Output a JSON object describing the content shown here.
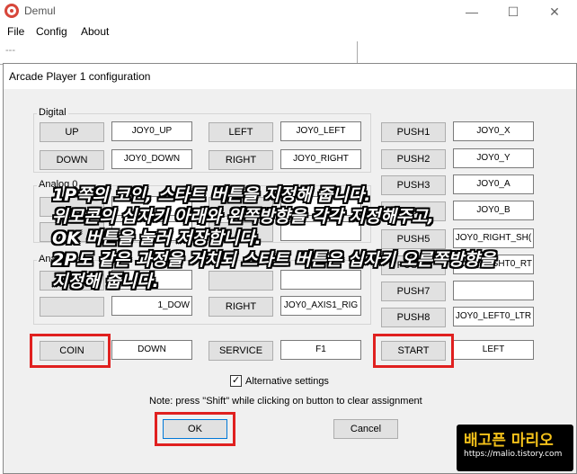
{
  "app": {
    "title": "Demul",
    "menu": [
      "File",
      "Config",
      "About"
    ],
    "status": "---",
    "window_buttons": [
      "—",
      "☐",
      "✕"
    ]
  },
  "dialog": {
    "title": "Arcade Player 1 configuration",
    "groups": {
      "digital": "Digital",
      "analog0": "Analog 0",
      "analog1": "Analog 1"
    },
    "rows": [
      {
        "btn": "UP",
        "val": "JOY0_UP",
        "btn2": "LEFT",
        "val2": "JOY0_LEFT"
      },
      {
        "btn": "DOWN",
        "val": "JOY0_DOWN",
        "btn2": "RIGHT",
        "val2": "JOY0_RIGHT"
      }
    ],
    "analog1_row": {
      "btn": "",
      "val": "1_DOW",
      "btn2": "RIGHT",
      "val2": "JOY0_AXIS1_RIG"
    },
    "push": [
      {
        "btn": "PUSH1",
        "val": "JOY0_X"
      },
      {
        "btn": "PUSH2",
        "val": "JOY0_Y"
      },
      {
        "btn": "PUSH3",
        "val": "JOY0_A"
      },
      {
        "btn": "PUSH4",
        "val": "JOY0_B"
      },
      {
        "btn": "PUSH5",
        "val": "JOY0_RIGHT_SH("
      },
      {
        "btn": "PUSH6",
        "val": "JOY0_RIGHT0_RT"
      },
      {
        "btn": "PUSH7",
        "val": ""
      },
      {
        "btn": "PUSH8",
        "val": "JOY0_LEFT0_LTR"
      }
    ],
    "coin": {
      "btn": "COIN",
      "val": "DOWN"
    },
    "service": {
      "btn": "SERVICE",
      "val": "F1"
    },
    "start": {
      "btn": "START",
      "val": "LEFT"
    },
    "alt_settings": "Alternative settings",
    "alt_checked": true,
    "note": "Note: press \"Shift\" while clicking on button to clear assignment",
    "ok": "OK",
    "cancel": "Cancel"
  },
  "overlay": [
    "1P쪽의 코인, 스타트 버튼을 지정해 줍니다.",
    "위모콘의 십자키 아래와 왼쪽방향을 각각 지정해주고,",
    "OK 버튼을 눌러 저장합니다.",
    "2P도 같은 과정을 거치되 스타트 버튼은 십자키 오른쪽방향을",
    "지정해 줍니다."
  ],
  "watermark": {
    "main": "배고픈 마리오",
    "url": "https://malio.tistory.com"
  },
  "colors": {
    "highlight": "#e0201f",
    "watermark": "#f5c21a"
  }
}
